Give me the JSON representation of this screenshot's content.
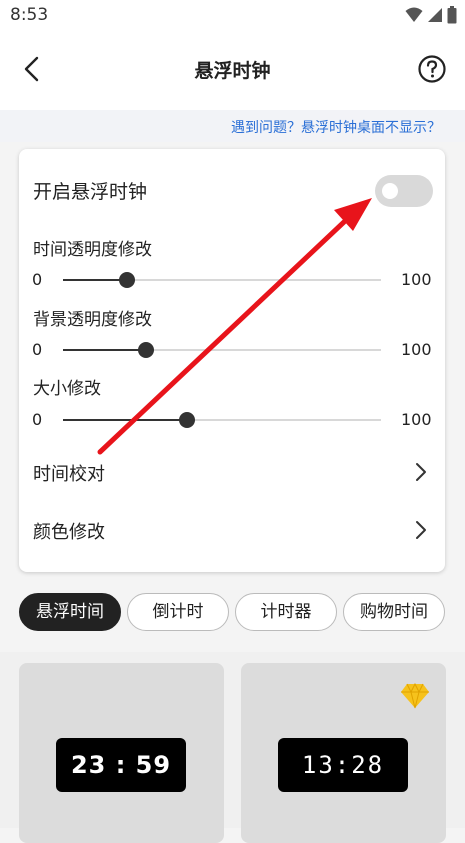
{
  "status_bar": {
    "time": "8:53"
  },
  "header": {
    "title": "悬浮时钟"
  },
  "notice": {
    "text": "遇到问题？悬浮时钟桌面不显示？"
  },
  "settings": {
    "enable_label": "开启悬浮时钟",
    "enable_on": false,
    "sliders": [
      {
        "label": "时间透明度修改",
        "min": "0",
        "max": "100",
        "value": 20
      },
      {
        "label": "背景透明度修改",
        "min": "0",
        "max": "100",
        "value": 26
      },
      {
        "label": "大小修改",
        "min": "0",
        "max": "100",
        "value": 39
      }
    ],
    "time_calibration_label": "时间校对",
    "color_label": "颜色修改"
  },
  "tabs": [
    {
      "label": "悬浮时间",
      "active": true
    },
    {
      "label": "倒计时",
      "active": false
    },
    {
      "label": "计时器",
      "active": false
    },
    {
      "label": "购物时间",
      "active": false
    }
  ],
  "clock_styles": [
    {
      "display": "23 : 59",
      "premium": false
    },
    {
      "display": "13:28",
      "premium": true
    }
  ],
  "colors": {
    "accent_link": "#2a6fd6",
    "active_tab": "#222222",
    "annotation_arrow": "#e8141b",
    "gem": "#f6c21c"
  }
}
